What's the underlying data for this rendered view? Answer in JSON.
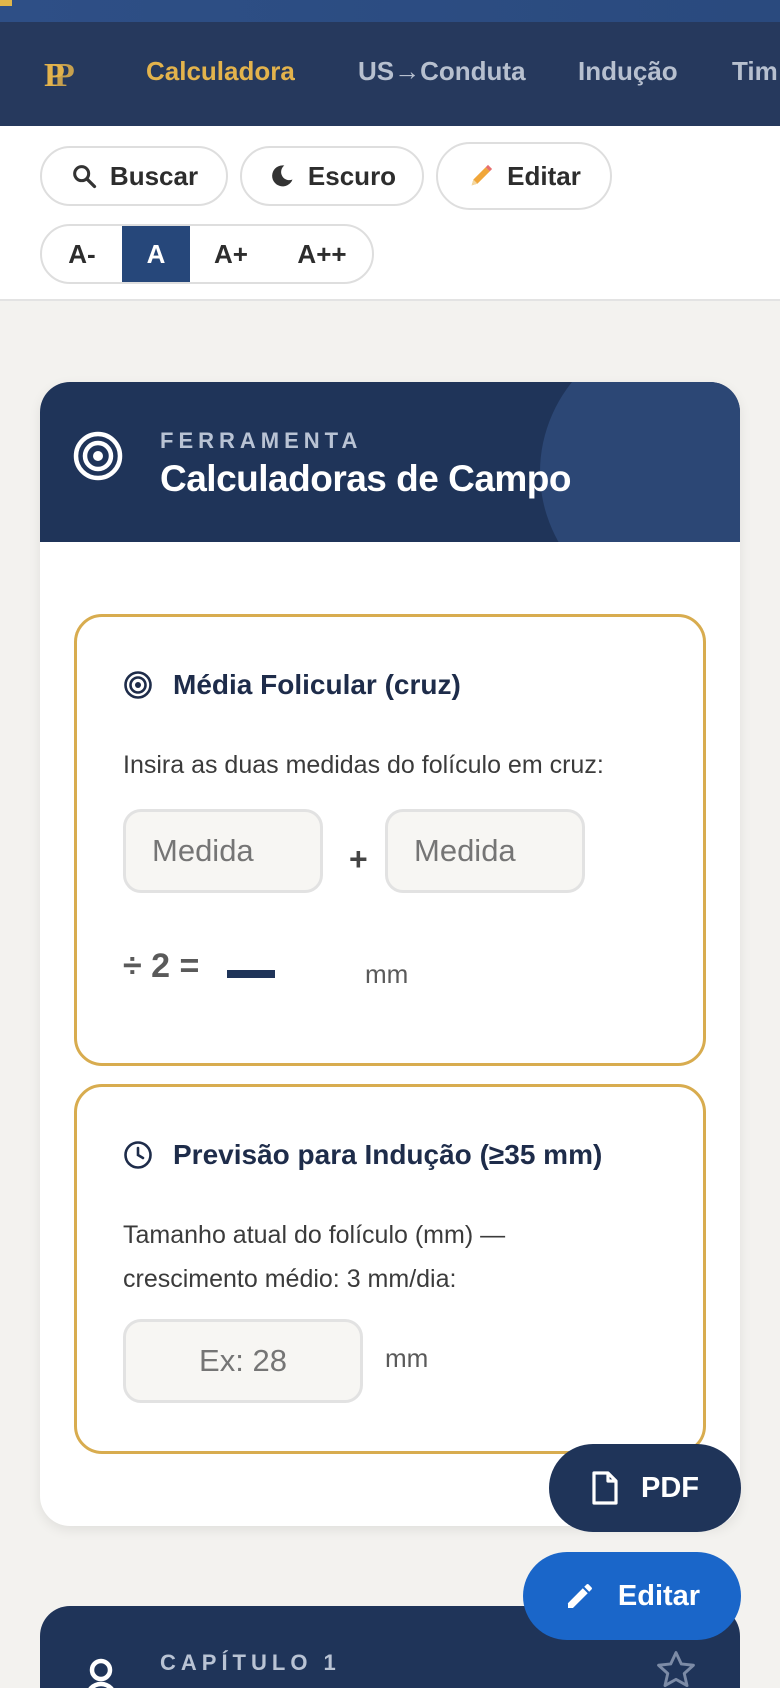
{
  "nav": {
    "logo_text": "PP",
    "items": [
      {
        "label": "Calculadora",
        "active": true
      },
      {
        "label": "US→Conduta",
        "active": false
      },
      {
        "label": "Indução",
        "active": false
      },
      {
        "label": "Tim",
        "active": false
      }
    ]
  },
  "toolbar": {
    "search_label": "Buscar",
    "dark_label": "Escuro",
    "edit_label": "Editar",
    "sizes": [
      "A-",
      "A",
      "A+",
      "A++"
    ],
    "active_size": "A"
  },
  "tool_card": {
    "eyebrow": "FERRAMENTA",
    "title": "Calculadoras de Campo"
  },
  "follicle_calc": {
    "title": "Média Folicular (cruz)",
    "instruction": "Insira as duas medidas do folículo em cruz:",
    "input1_placeholder": "Medida",
    "input2_placeholder": "Medida",
    "plus": "+",
    "divide_text": "÷ 2 =",
    "unit": "mm"
  },
  "induction_calc": {
    "title": "Previsão para Indução (≥35 mm)",
    "instruction_line1": "Tamanho atual do folículo (mm) —",
    "instruction_line2": "crescimento médio: 3 mm/dia:",
    "input_placeholder": "Ex: 28",
    "unit": "mm"
  },
  "fab": {
    "pdf_label": "PDF",
    "edit_label": "Editar"
  },
  "chapter": {
    "label": "CAPÍTULO 1"
  },
  "colors": {
    "navy": "#1f3459",
    "gold": "#d8ac4f",
    "blue_fab": "#1a66c9",
    "nav_active": "#e3b34c"
  },
  "icons": [
    "search-icon",
    "moon-icon",
    "pencil-icon",
    "target-icon",
    "clock-icon",
    "file-icon",
    "edit-icon",
    "person-icon",
    "star-icon"
  ]
}
